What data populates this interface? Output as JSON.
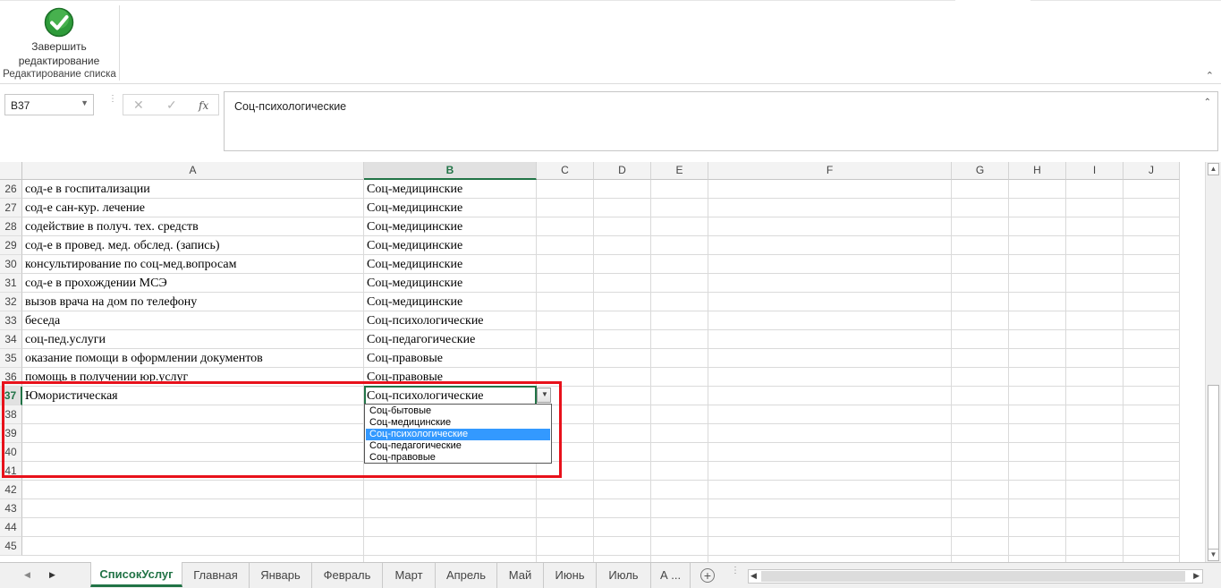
{
  "ribbon": {
    "finish_button": "Завершить редактирование",
    "finish_line1": "Завершить",
    "finish_line2": "редактирование",
    "group_label": "Редактирование списка",
    "collapse_icon": "chevron-up-icon"
  },
  "formula_bar": {
    "name_box": "B37",
    "cancel_icon": "cross-icon",
    "enter_icon": "check-icon",
    "fx_label": "fx",
    "value": "Соц-психологические"
  },
  "columns": [
    "A",
    "B",
    "C",
    "D",
    "E",
    "F",
    "G",
    "H",
    "I",
    "J"
  ],
  "selected_column": "B",
  "rows": [
    {
      "num": "26",
      "a": "сод-е в госпитализации",
      "b": "Соц-медицинские"
    },
    {
      "num": "27",
      "a": "сод-е сан-кур. лечение",
      "b": "Соц-медицинские"
    },
    {
      "num": "28",
      "a": "содействие в получ. тех. средств",
      "b": "Соц-медицинские"
    },
    {
      "num": "29",
      "a": "сод-е в провед. мед. обслед. (запись)",
      "b": "Соц-медицинские"
    },
    {
      "num": "30",
      "a": "консультирование по соц-мед.вопросам",
      "b": "Соц-медицинские"
    },
    {
      "num": "31",
      "a": "сод-е в прохождении МСЭ",
      "b": "Соц-медицинские"
    },
    {
      "num": "32",
      "a": "вызов врача на дом по телефону",
      "b": "Соц-медицинские"
    },
    {
      "num": "33",
      "a": "беседа",
      "b": "Соц-психологические"
    },
    {
      "num": "34",
      "a": "соц-пед.услуги",
      "b": "Соц-педагогические"
    },
    {
      "num": "35",
      "a": "оказание помощи в оформлении документов",
      "b": "Соц-правовые"
    },
    {
      "num": "36",
      "a": "помощь в получении юр.услуг",
      "b": "Соц-правовые"
    },
    {
      "num": "37",
      "a": "Юмористическая",
      "b": "Соц-психологические"
    },
    {
      "num": "38",
      "a": "",
      "b": ""
    },
    {
      "num": "39",
      "a": "",
      "b": ""
    },
    {
      "num": "40",
      "a": "",
      "b": ""
    },
    {
      "num": "41",
      "a": "",
      "b": ""
    },
    {
      "num": "42",
      "a": "",
      "b": ""
    },
    {
      "num": "43",
      "a": "",
      "b": ""
    },
    {
      "num": "44",
      "a": "",
      "b": ""
    },
    {
      "num": "45",
      "a": "",
      "b": ""
    }
  ],
  "selected_row": "37",
  "dropdown": {
    "options": [
      "Соц-бытовые",
      "Соц-медицинские",
      "Соц-психологические",
      "Соц-педагогические",
      "Соц-правовые"
    ],
    "highlighted": "Соц-психологические"
  },
  "highlight_color": "#e8111b",
  "accent_color": "#217346",
  "sheet_tabs": [
    "СписокУслуг",
    "Главная",
    "Январь",
    "Февраль",
    "Март",
    "Апрель",
    "Май",
    "Июнь",
    "Июль",
    "А ..."
  ],
  "active_sheet": "СписокУслуг",
  "add_sheet_icon": "plus-circle-icon"
}
